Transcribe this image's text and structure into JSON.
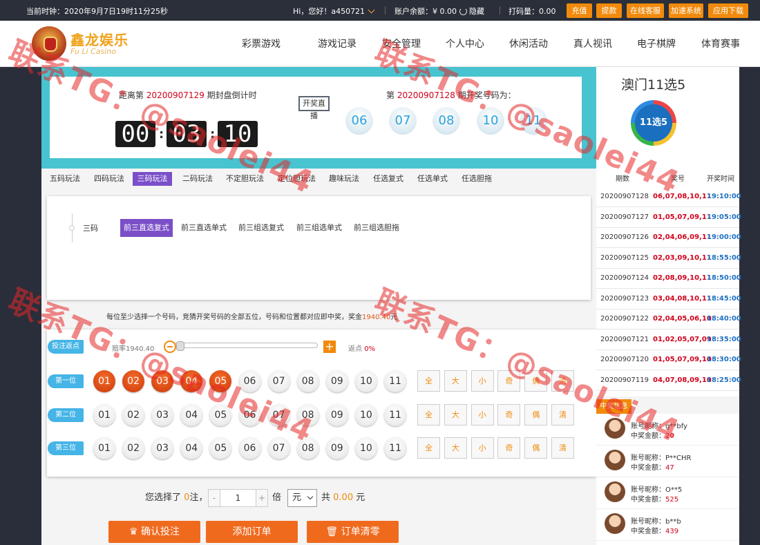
{
  "topbar": {
    "clock": "当前时钟：2020年9月7日19时11分25秒",
    "greeting": "Hi，您好！a450721",
    "balance_label": "账户余额：",
    "balance_value": "¥ 0.00",
    "hide": "隐藏",
    "code": "打码量：0.00",
    "buttons": [
      "充值",
      "提款",
      "在线客服",
      "加速系统",
      "应用下载"
    ]
  },
  "brand": {
    "name": "鑫龙娱乐",
    "sub": "Fu Li Casino"
  },
  "nav": [
    "彩票游戏",
    "游戏记录",
    "安全管理",
    "个人中心",
    "休闲活动",
    "真人视讯",
    "电子棋牌",
    "体育赛事"
  ],
  "countdown": {
    "prefix": "距离第",
    "issue": "20200907129",
    "suffix": "期封盘倒计时",
    "hours": "00",
    "minutes": "03",
    "seconds": "10",
    "colon": ":"
  },
  "live_button": "开奖直播",
  "last_draw": {
    "prefix": "第",
    "issue": "20200907128",
    "suffix": "期开奖号码为：",
    "numbers": [
      "06",
      "07",
      "08",
      "10",
      "11"
    ]
  },
  "game": {
    "name": "澳门11选5",
    "logo_text": "11选5"
  },
  "play_tabs": [
    {
      "label": "五码玩法",
      "active": false
    },
    {
      "label": "四码玩法",
      "active": false
    },
    {
      "label": "三码玩法",
      "active": true
    },
    {
      "label": "二码玩法",
      "active": false
    },
    {
      "label": "不定胆玩法",
      "active": false
    },
    {
      "label": "定位胆玩法",
      "active": false
    },
    {
      "label": "趣味玩法",
      "active": false
    },
    {
      "label": "任选复式",
      "active": false
    },
    {
      "label": "任选单式",
      "active": false
    },
    {
      "label": "任选胆拖",
      "active": false
    }
  ],
  "sub": {
    "group": "三码",
    "items": [
      {
        "label": "前三直选复式",
        "active": true
      },
      {
        "label": "前三直选单式",
        "active": false
      },
      {
        "label": "前三组选复式",
        "active": false
      },
      {
        "label": "前三组选单式",
        "active": false
      },
      {
        "label": "前三组选胆拖",
        "active": false
      }
    ]
  },
  "hint": {
    "text": "每位至少选择一个号码，竞猜开奖号码的全部五位，号码和位置都对应即中奖，奖金",
    "prize": "1940.40",
    "unit": "元"
  },
  "rebate": {
    "label": "投注返点",
    "odds": "赔率1940.40",
    "rate_label": "返点",
    "rate": "0%"
  },
  "positions": [
    {
      "label": "第一位",
      "numbers": [
        "01",
        "02",
        "03",
        "04",
        "05",
        "06",
        "07",
        "08",
        "09",
        "10",
        "11"
      ],
      "selected": [
        true,
        true,
        true,
        true,
        true,
        false,
        false,
        false,
        false,
        false,
        false
      ]
    },
    {
      "label": "第二位",
      "numbers": [
        "01",
        "02",
        "03",
        "04",
        "05",
        "06",
        "07",
        "08",
        "09",
        "10",
        "11"
      ],
      "selected": [
        false,
        false,
        false,
        false,
        false,
        false,
        false,
        false,
        false,
        false,
        false
      ]
    },
    {
      "label": "第三位",
      "numbers": [
        "01",
        "02",
        "03",
        "04",
        "05",
        "06",
        "07",
        "08",
        "09",
        "10",
        "11"
      ],
      "selected": [
        false,
        false,
        false,
        false,
        false,
        false,
        false,
        false,
        false,
        false,
        false
      ]
    }
  ],
  "quick": [
    "全",
    "大",
    "小",
    "奇",
    "偶",
    "清"
  ],
  "order": {
    "picked_prefix": "您选择了",
    "picked": "0",
    "picked_suffix": "注，",
    "minus": "-",
    "multiple": "1",
    "plus": "+",
    "times": "倍",
    "unit": "元",
    "total_prefix": "共",
    "total": "0.00",
    "total_suffix": "元"
  },
  "buttons": {
    "confirm": "确认投注",
    "add": "添加订单",
    "clear": "订单清零"
  },
  "results": {
    "headers": [
      "期数",
      "奖号",
      "开奖时间"
    ],
    "rows": [
      [
        "20200907128",
        "06,07,08,10,11",
        "19:10:00"
      ],
      [
        "20200907127",
        "01,05,07,09,11",
        "19:05:00"
      ],
      [
        "20200907126",
        "02,04,06,09,11",
        "19:00:00"
      ],
      [
        "20200907125",
        "02,03,09,10,11",
        "18:55:00"
      ],
      [
        "20200907124",
        "02,08,09,10,11",
        "18:50:00"
      ],
      [
        "20200907123",
        "03,04,08,10,11",
        "18:45:00"
      ],
      [
        "20200907122",
        "02,04,05,06,10",
        "18:40:00"
      ],
      [
        "20200907121",
        "01,02,05,07,09",
        "18:35:00"
      ],
      [
        "20200907120",
        "01,05,07,09,10",
        "18:30:00"
      ],
      [
        "20200907119",
        "04,07,08,09,10",
        "18:25:00"
      ]
    ]
  },
  "winners": {
    "tag": "中奖信息",
    "items": [
      {
        "name": "账号昵称：g**bfy",
        "amount_label": "中奖金额：",
        "amount": "20"
      },
      {
        "name": "账号昵称：P**CHR",
        "amount_label": "中奖金额：",
        "amount": "47"
      },
      {
        "name": "账号昵称：O**5",
        "amount_label": "中奖金额：",
        "amount": "525"
      },
      {
        "name": "账号昵称：b**b",
        "amount_label": "中奖金额：",
        "amount": "439"
      }
    ]
  },
  "watermark": {
    "text1": "联系TG：@saolei44",
    "text2": "联系TG：@saolei44"
  },
  "colors": {
    "accent": "#f18a0c",
    "purple": "#7a4fc8",
    "teal": "#48c3d0",
    "red": "#d0021b",
    "blue": "#1f6fc2"
  }
}
